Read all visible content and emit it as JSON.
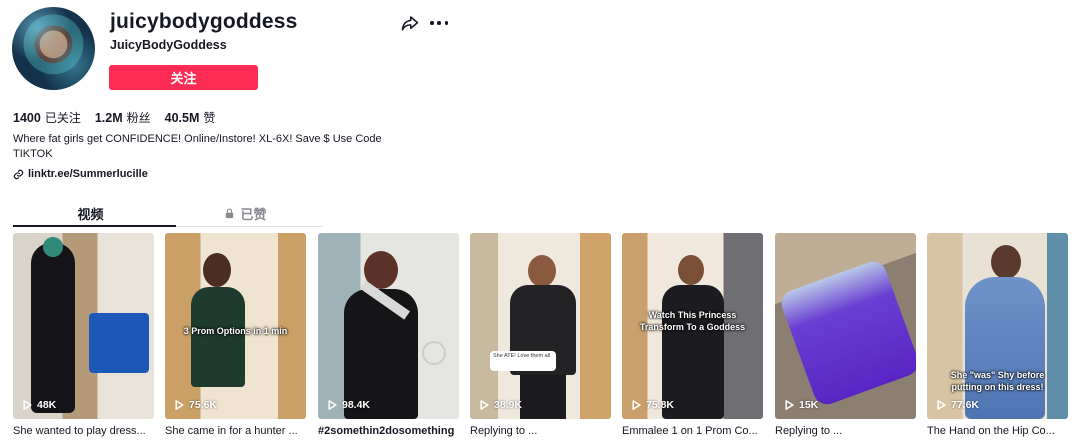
{
  "profile": {
    "username": "juicybodygoddess",
    "nickname": "JuicyBodyGoddess",
    "follow_label": "关注",
    "stats": [
      {
        "value": "1400",
        "label": "已关注"
      },
      {
        "value": "1.2M",
        "label": "粉丝"
      },
      {
        "value": "40.5M",
        "label": "赞"
      }
    ],
    "bio": "Where fat girls get CONFIDENCE! Online/Instore! XL-6X! Save $ Use Code TIKTOK",
    "link": "linktr.ee/Summerlucille"
  },
  "tabs": [
    {
      "label": "视频"
    },
    {
      "label": "已赞"
    }
  ],
  "colors": {
    "accent": "#fe2c55",
    "text": "#161823",
    "muted": "#8a8b91"
  },
  "icons": [
    "share-icon",
    "more-icon",
    "link-icon",
    "lock-icon",
    "play-icon"
  ],
  "videos": [
    {
      "views": "48K",
      "caption": "She wanted to play dress...",
      "overlay": ""
    },
    {
      "views": "75.6K",
      "caption": "She came in for a hunter ...",
      "overlay": "3 Prom Options in 1 min"
    },
    {
      "views": "98.4K",
      "caption": "#2somethin2dosomething",
      "overlay": ""
    },
    {
      "views": "38.9K",
      "caption": "Replying to ...",
      "overlay": "She ATE! Love them all"
    },
    {
      "views": "75.8K",
      "caption": "Emmalee 1 on 1 Prom Co...",
      "overlay": "Watch This Princess Transform To a Goddess"
    },
    {
      "views": "15K",
      "caption": "Replying to ...",
      "overlay": ""
    },
    {
      "views": "77.6K",
      "caption": "The Hand on the Hip Co...",
      "overlay": "She \"was\" Shy before putting on this dress!"
    }
  ]
}
